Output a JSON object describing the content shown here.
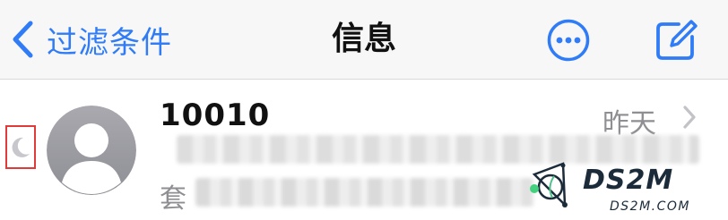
{
  "nav": {
    "back_label": "过滤条件",
    "title": "信息"
  },
  "message": {
    "sender": "10010",
    "date": "昨天",
    "preview_line2_start": "套"
  },
  "icons": {
    "back": "chevron-left-icon",
    "more": "ellipsis-circle-icon",
    "compose": "compose-icon",
    "dnd": "moon-icon",
    "avatar": "person-avatar-icon",
    "row_chevron": "chevron-right-icon"
  },
  "watermark": {
    "brand": "DS2M",
    "url": "DS2M.COM"
  },
  "colors": {
    "accent": "#2f7cf6",
    "secondary_text": "#8e8e93",
    "highlight_box": "#e03a3a",
    "avatar_gray": "#a7a7ad"
  }
}
